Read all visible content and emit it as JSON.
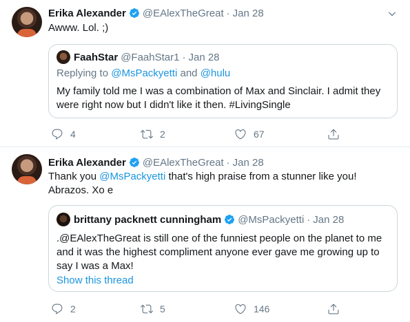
{
  "tweets": [
    {
      "author": {
        "name": "Erika Alexander",
        "handle": "@EAlexTheGreat",
        "date": "Jan 28",
        "separator": "·"
      },
      "text": "Awww. Lol. ;)",
      "quote": {
        "author": {
          "name": "FaahStar",
          "handle": "@FaahStar1",
          "date": "Jan 28",
          "separator": "·"
        },
        "replying": {
          "prefix": "Replying to",
          "user1": "@MsPackyetti",
          "and": "and",
          "user2": "@hulu"
        },
        "text": "My family told me I was a combination of Max and Sinclair. I admit they were right now but I didn't like it then. #LivingSingle"
      },
      "actions": {
        "replies": "4",
        "retweets": "2",
        "likes": "67"
      }
    },
    {
      "author": {
        "name": "Erika Alexander",
        "handle": "@EAlexTheGreat",
        "date": "Jan 28",
        "separator": "·"
      },
      "text_before": "Thank you ",
      "text_mention": "@MsPackyetti",
      "text_after": " that's high praise from a stunner like you! Abrazos. Xo e",
      "quote": {
        "author": {
          "name": "brittany packnett cunningham",
          "handle": "@MsPackyetti",
          "date": "Jan 28",
          "separator": "·"
        },
        "text": ".@EAlexTheGreat is still one of the funniest people on the planet to me and it was the highest compliment anyone ever gave me growing up to say I was a Max!",
        "show_thread": "Show this thread"
      },
      "actions": {
        "replies": "2",
        "retweets": "5",
        "likes": "146"
      }
    }
  ],
  "colors": {
    "accent": "#1b95e0",
    "muted": "#657786",
    "verified": "#1da1f2",
    "border": "#ccd6dd"
  }
}
